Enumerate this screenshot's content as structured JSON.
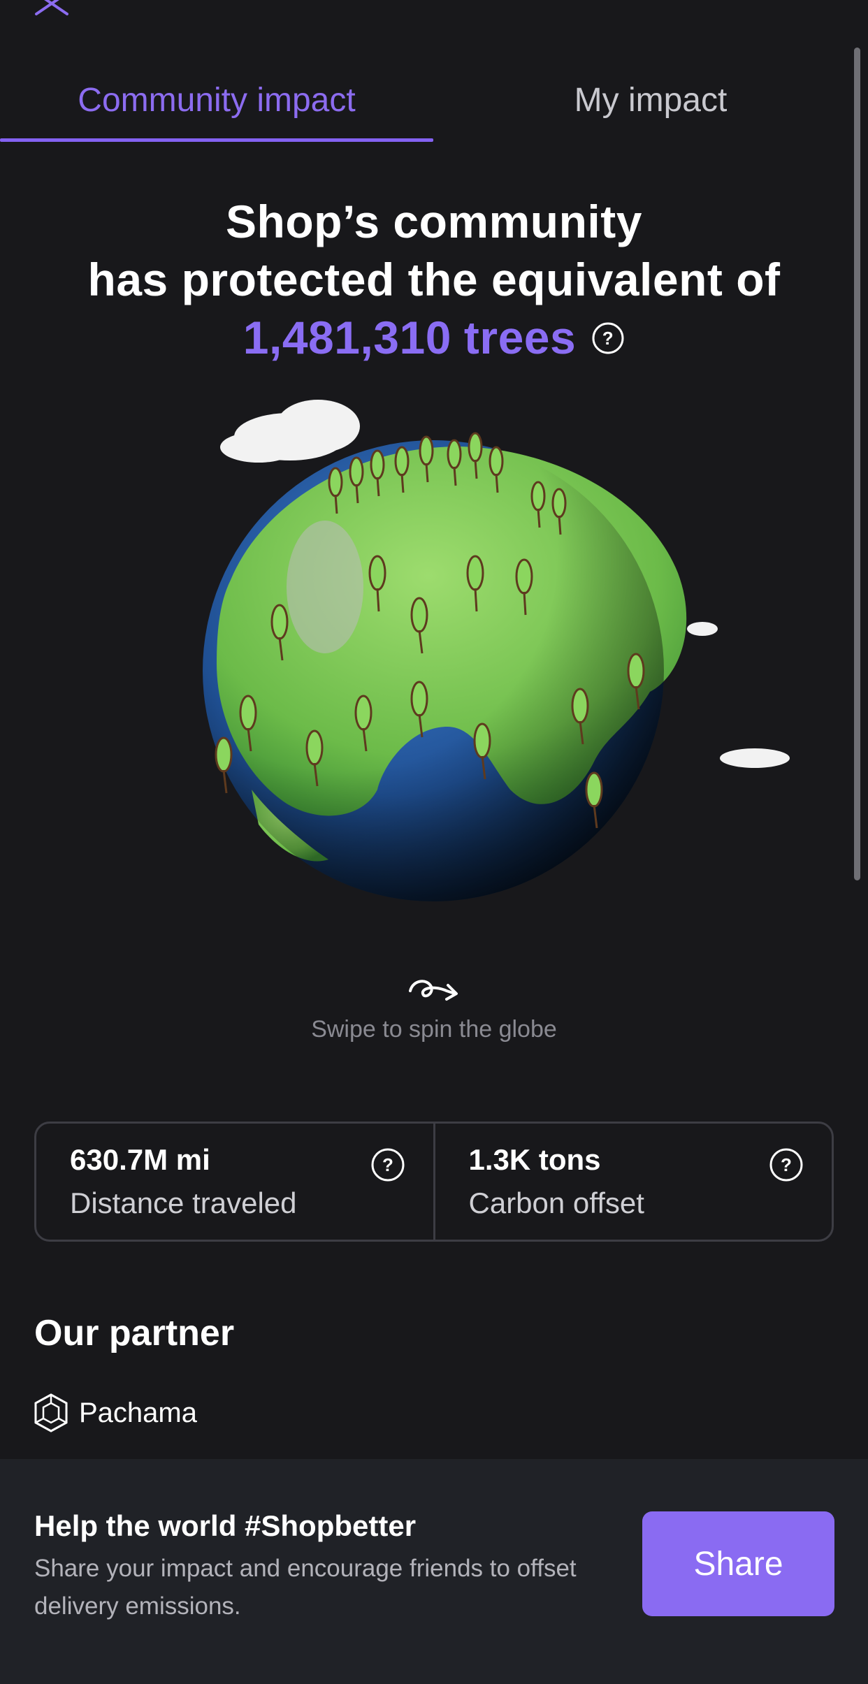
{
  "tabs": {
    "community": "Community impact",
    "my": "My impact"
  },
  "headline": {
    "line1": "Shop’s community",
    "line2": "has protected the equivalent of",
    "tree_count": "1,481,310",
    "tree_unit": "trees"
  },
  "swipe_hint": "Swipe to spin the globe",
  "stats": {
    "distance": {
      "value": "630.7M mi",
      "label": "Distance traveled"
    },
    "carbon": {
      "value": "1.3K tons",
      "label": "Carbon offset"
    }
  },
  "partner": {
    "title": "Our partner",
    "name": "Pachama"
  },
  "footer": {
    "title": "Help the world #Shopbetter",
    "description": "Share your impact and encourage friends to offset delivery emissions.",
    "share_label": "Share"
  },
  "colors": {
    "accent": "#8a6bf2",
    "background": "#18181b",
    "footer_bg": "#202227"
  },
  "icons": {
    "close": "close-icon",
    "help": "question-circle-icon",
    "swipe": "swipe-arrow-icon",
    "partner_logo": "pachama-logo"
  }
}
